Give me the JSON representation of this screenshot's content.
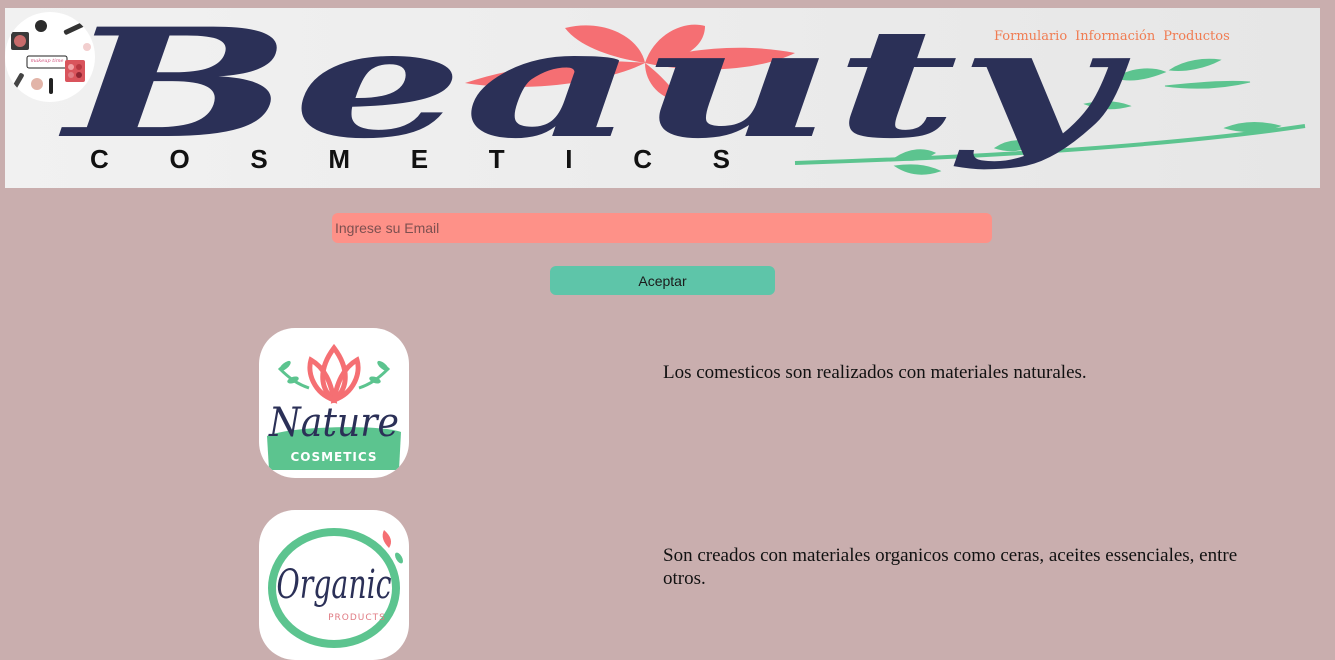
{
  "header": {
    "logo_lettering": "makeup time",
    "banner_brand": "Beauty",
    "banner_sub": "COSMETICS"
  },
  "nav": {
    "items": [
      "Formulario",
      "Información",
      "Productos"
    ]
  },
  "form": {
    "email_placeholder": "Ingrese su Email",
    "email_value": "",
    "accept_label": "Aceptar"
  },
  "features": [
    {
      "badge_title": "Nature",
      "badge_sub": "COSMETICS",
      "text": "Los comesticos son realizados con materiales naturales."
    },
    {
      "badge_title": "Organic",
      "badge_sub": "PRODUCTS",
      "text": "Son creados con materiales organicos como ceras, aceites essenciales, entre otros."
    }
  ],
  "colors": {
    "page_bg": "#c9aeae",
    "nav_text": "#f07c52",
    "input_bg": "#fe9188",
    "button_bg": "#5ec5a9",
    "brand_navy": "#2b3057",
    "brand_pink": "#f26d72",
    "brand_green": "#5cc48f"
  }
}
